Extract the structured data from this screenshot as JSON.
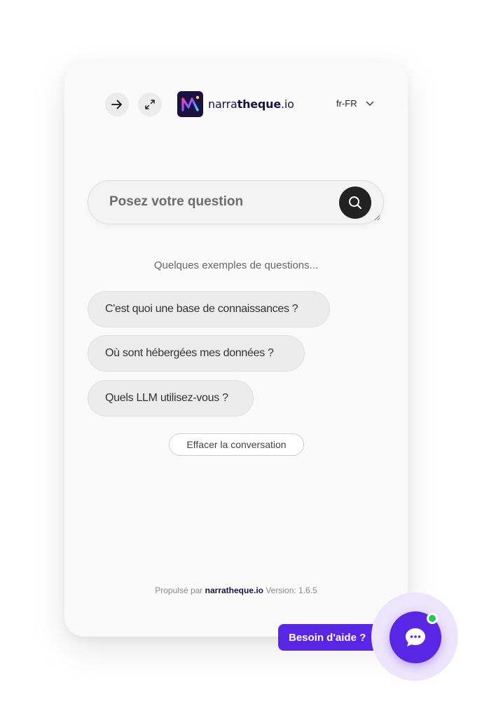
{
  "header": {
    "collapse_button_icon": "arrow-right-icon",
    "expand_button_icon": "expand-icon",
    "brand_prefix": "narra",
    "brand_bold": "theque",
    "brand_suffix": ".io",
    "language": "fr-FR"
  },
  "search": {
    "placeholder": "Posez votre question",
    "value": "",
    "button_icon": "search-icon"
  },
  "examples": {
    "title": "Quelques exemples de questions...",
    "items": [
      "C'est quoi une base de connaissances ?",
      "Où sont hébergées mes données ?",
      "Quels LLM utilisez-vous ?"
    ]
  },
  "clear_label": "Effacer la conversation",
  "footer": {
    "powered_by": "Propulsé par",
    "brand": "narratheque.io",
    "version": "Version: 1.6.5"
  },
  "help_widget": {
    "label": "Besoin d'aide ?",
    "icon": "chat-bubble-icon",
    "status": "online"
  },
  "colors": {
    "accent": "#5a26e6",
    "brand_dark": "#1b1140",
    "online": "#22c55e"
  }
}
